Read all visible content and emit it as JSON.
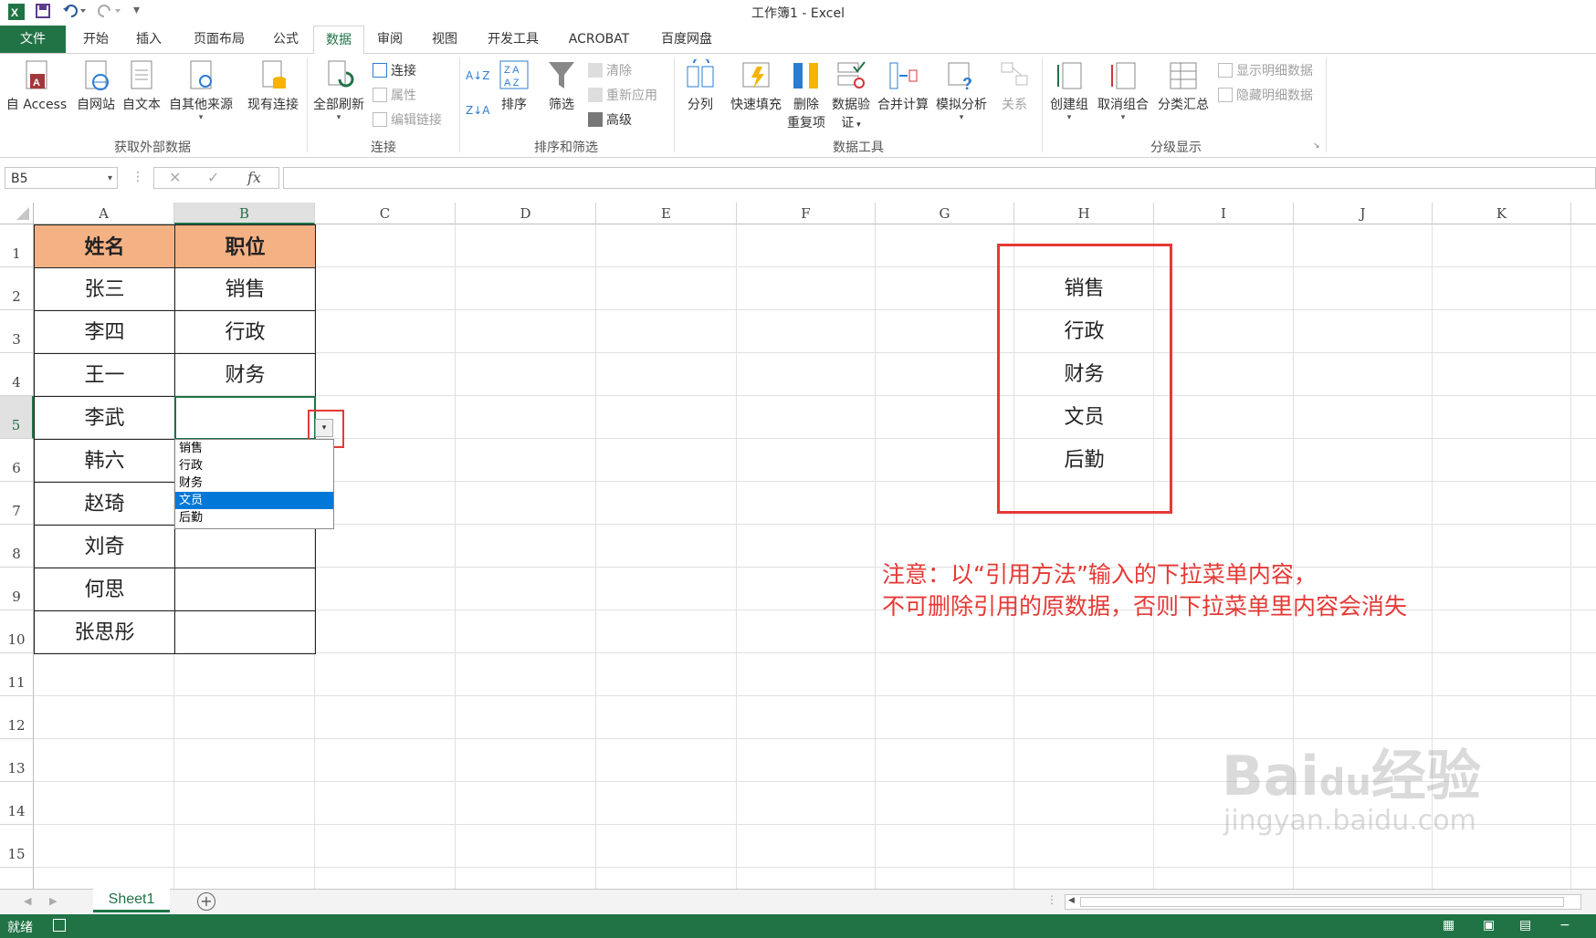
{
  "titlebar": {
    "title": "工作簿1 - Excel",
    "app_icon": "excel-icon"
  },
  "tabs": [
    "文件",
    "开始",
    "插入",
    "页面布局",
    "公式",
    "数据",
    "审阅",
    "视图",
    "开发工具",
    "ACROBAT",
    "百度网盘"
  ],
  "active_tab": "数据",
  "ribbon": {
    "from_access": "自 Access",
    "from_web": "自网站",
    "from_text": "自文本",
    "from_other": "自其他来源",
    "existing_conn": "现有连接",
    "refresh_all": "全部刷新",
    "connections": "连接",
    "properties": "属性",
    "edit_links": "编辑链接",
    "sort": "排序",
    "filter": "筛选",
    "clear": "清除",
    "reapply": "重新应用",
    "advanced": "高级",
    "text_to_cols": "分列",
    "flash_fill": "快速填充",
    "remove_dup_1": "删除",
    "remove_dup_2": "重复项",
    "data_valid_1": "数据验",
    "data_valid_2": "证",
    "consolidate": "合并计算",
    "what_if": "模拟分析",
    "relations": "关系",
    "group": "创建组",
    "ungroup": "取消组合",
    "subtotal": "分类汇总",
    "show_detail": "显示明细数据",
    "hide_detail": "隐藏明细数据",
    "g_external": "获取外部数据",
    "g_conn": "连接",
    "g_sort": "排序和筛选",
    "g_tools": "数据工具",
    "g_outline": "分级显示"
  },
  "formula_bar": {
    "name_box": "B5",
    "fx": "fx",
    "formula": ""
  },
  "columns": [
    "A",
    "B",
    "C",
    "D",
    "E",
    "F",
    "G",
    "H",
    "I",
    "J",
    "K"
  ],
  "rows": [
    "1",
    "2",
    "3",
    "4",
    "5",
    "6",
    "7",
    "8",
    "9",
    "10",
    "11",
    "12",
    "13",
    "14",
    "15"
  ],
  "table": {
    "header_name": "姓名",
    "header_pos": "职位",
    "names": [
      "张三",
      "李四",
      "王一",
      "李武",
      "韩六",
      "赵琦",
      "刘奇",
      "何思",
      "张思彤"
    ],
    "positions": [
      "销售",
      "行政",
      "财务",
      "",
      "",
      "",
      "",
      "",
      ""
    ]
  },
  "source_list": [
    "销售",
    "行政",
    "财务",
    "文员",
    "后勤"
  ],
  "dropdown": {
    "options": [
      "销售",
      "行政",
      "财务",
      "文员",
      "后勤"
    ],
    "selected_index": 3
  },
  "note": {
    "line1": "注意：以“引用方法”输入的下拉菜单内容，",
    "line2": "不可删除引用的原数据，否则下拉菜单里内容会消失"
  },
  "sheet_tab": "Sheet1",
  "status": "就绪",
  "watermark": "Baidu经验 jingyan.baidu.com",
  "colors": {
    "excel_green": "#217346",
    "header_fill": "#f4b183",
    "red_annotation": "#e53935",
    "selection_blue": "#0078d7"
  }
}
